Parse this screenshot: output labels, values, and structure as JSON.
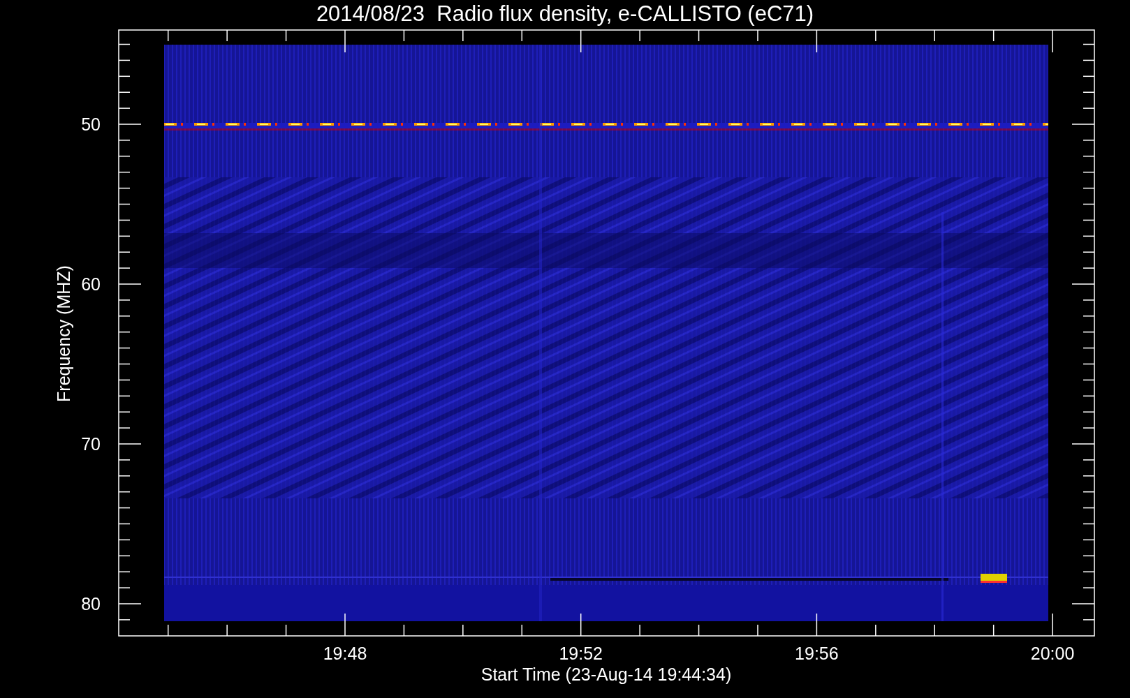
{
  "title": "2014/08/23  Radio flux density, e-CALLISTO (eC71)",
  "y_axis": {
    "label": "Frequency (MHZ)",
    "ticks": [
      "50",
      "60",
      "70",
      "80"
    ]
  },
  "x_axis": {
    "label": "Start Time (23-Aug-14 19:44:34)",
    "ticks": [
      "19:48",
      "19:52",
      "19:56",
      "20:00"
    ]
  }
}
